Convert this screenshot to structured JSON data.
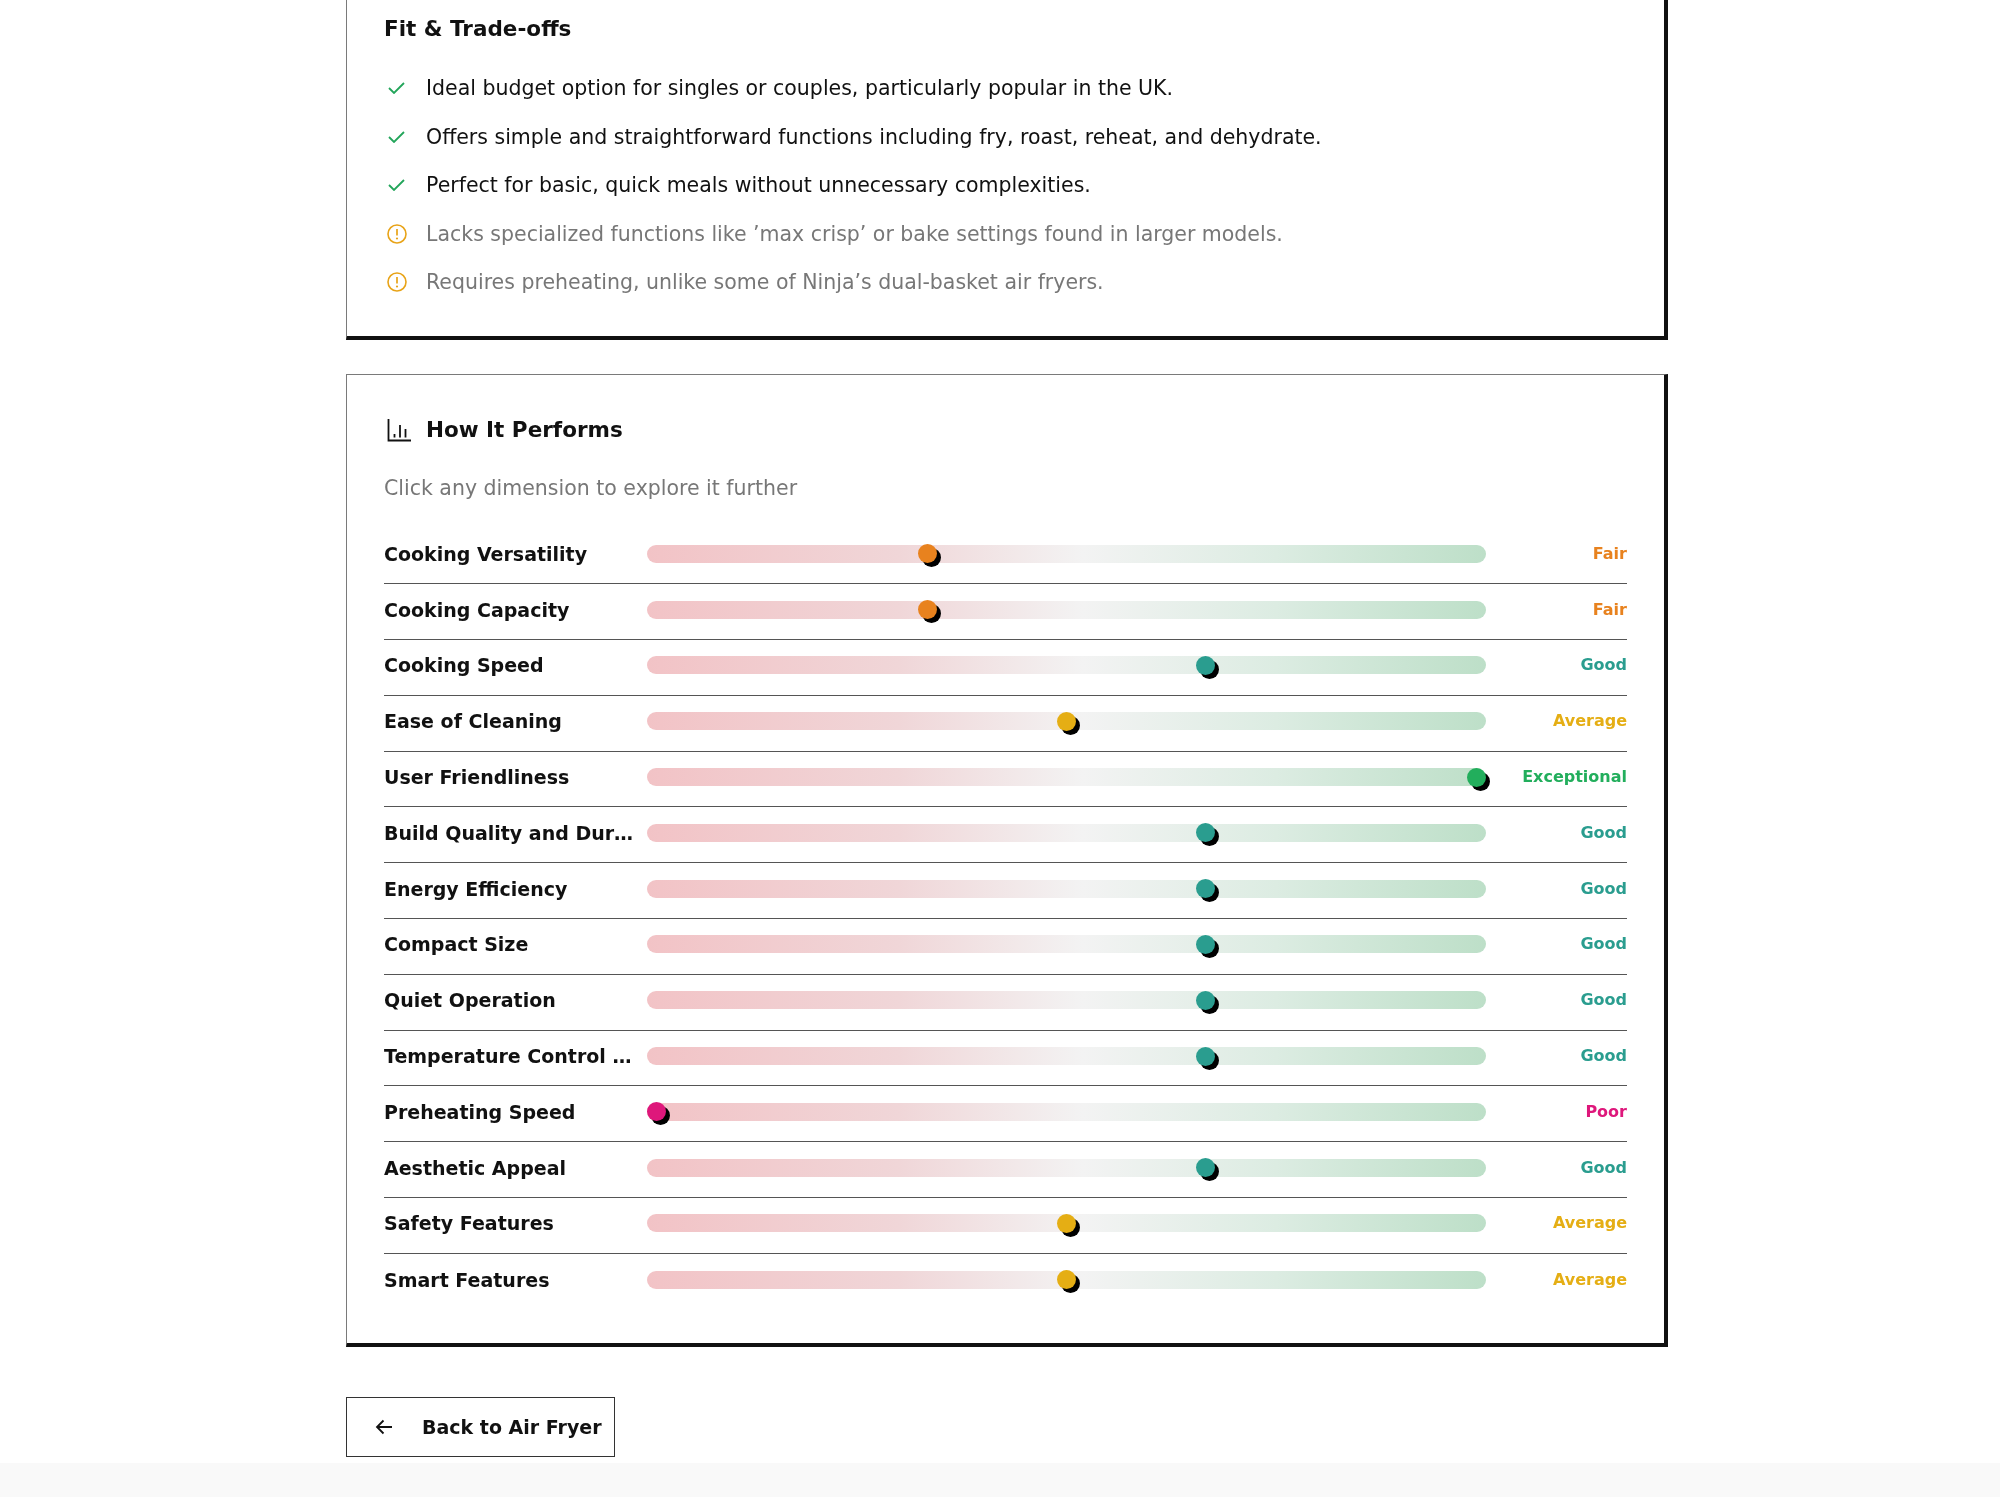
{
  "fit_tradeoffs": {
    "title": "Fit & Trade-offs",
    "items": [
      {
        "kind": "pro",
        "text": "Ideal budget option for singles or couples, particularly popular in the UK."
      },
      {
        "kind": "pro",
        "text": "Offers simple and straightforward functions including fry, roast, reheat, and dehydrate."
      },
      {
        "kind": "pro",
        "text": "Perfect for basic, quick meals without unnecessary complexities."
      },
      {
        "kind": "con",
        "text": "Lacks specialized functions like ’max crisp’ or bake settings found in larger models."
      },
      {
        "kind": "con",
        "text": "Requires preheating, unlike some of Ninja’s dual-basket air fryers."
      }
    ]
  },
  "performance": {
    "title": "How It Performs",
    "subtitle": "Click any dimension to explore it further",
    "rows": [
      {
        "name": "Cooking Versatility",
        "level": 0.33,
        "rating": "Fair",
        "color": "#e8821e"
      },
      {
        "name": "Cooking Capacity",
        "level": 0.33,
        "rating": "Fair",
        "color": "#e8821e"
      },
      {
        "name": "Cooking Speed",
        "level": 0.67,
        "rating": "Good",
        "color": "#2a9d8f"
      },
      {
        "name": "Ease of Cleaning",
        "level": 0.5,
        "rating": "Average",
        "color": "#e5ae14"
      },
      {
        "name": "User Friendliness",
        "level": 1,
        "rating": "Exceptional",
        "color": "#22ae5c"
      },
      {
        "name": "Build Quality and Dur…",
        "level": 0.67,
        "rating": "Good",
        "color": "#2a9d8f"
      },
      {
        "name": "Energy Efficiency",
        "level": 0.67,
        "rating": "Good",
        "color": "#2a9d8f"
      },
      {
        "name": "Compact Size",
        "level": 0.67,
        "rating": "Good",
        "color": "#2a9d8f"
      },
      {
        "name": "Quiet Operation",
        "level": 0.67,
        "rating": "Good",
        "color": "#2a9d8f"
      },
      {
        "name": "Temperature Control …",
        "level": 0.67,
        "rating": "Good",
        "color": "#2a9d8f"
      },
      {
        "name": "Preheating Speed",
        "level": 0,
        "rating": "Poor",
        "color": "#de177b"
      },
      {
        "name": "Aesthetic Appeal",
        "level": 0.67,
        "rating": "Good",
        "color": "#2a9d8f"
      },
      {
        "name": "Safety Features",
        "level": 0.5,
        "rating": "Average",
        "color": "#e5ae14"
      },
      {
        "name": "Smart Features",
        "level": 0.5,
        "rating": "Average",
        "color": "#e5ae14"
      }
    ]
  },
  "back_button": {
    "label": "Back to Air Fryer"
  }
}
